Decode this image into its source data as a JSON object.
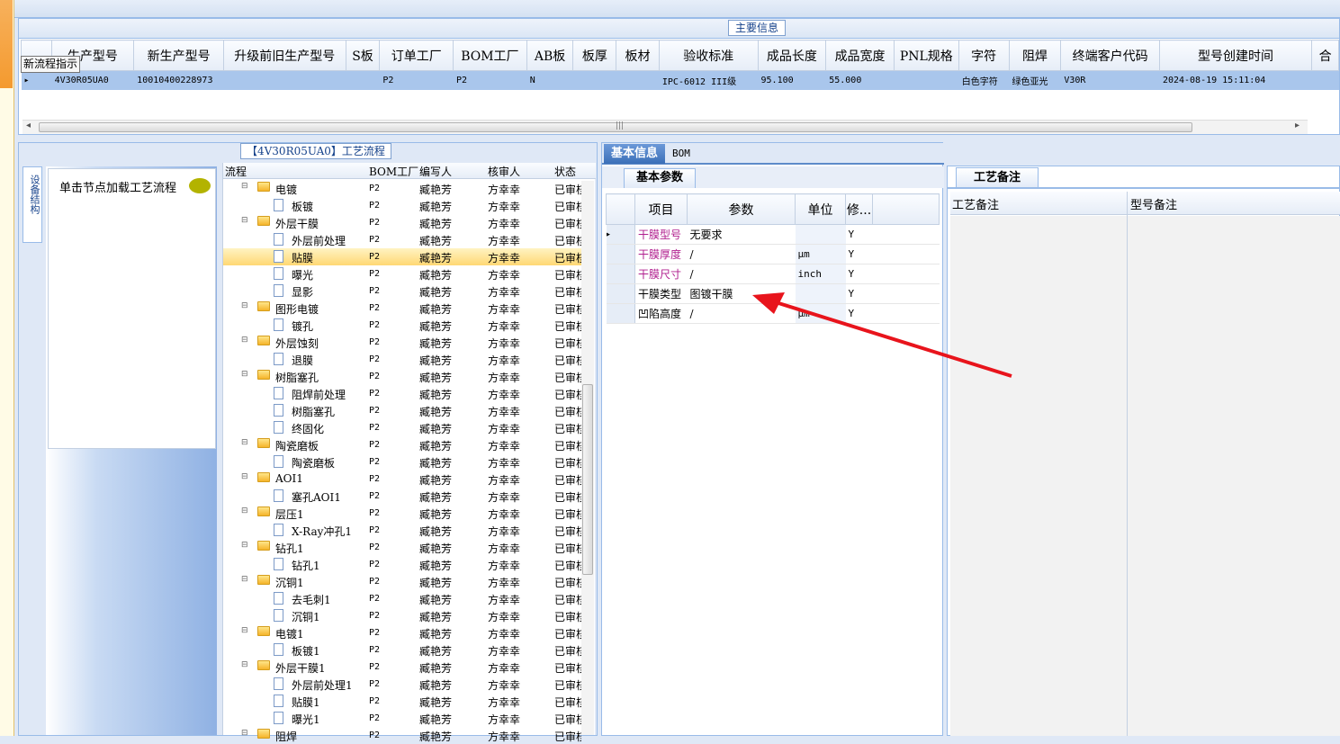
{
  "main_panel": {
    "title": "主要信息",
    "tooltip": "新流程指示",
    "columns": [
      "生产型号",
      "新生产型号",
      "升级前旧生产型号",
      "S板",
      "订单工厂",
      "BOM工厂",
      "AB板",
      "板厚",
      "板材",
      "验收标准",
      "成品长度",
      "成品宽度",
      "PNL规格",
      "字符",
      "阻焊",
      "终端客户代码",
      "型号创建时间",
      "合"
    ],
    "row": [
      "4V30R05UA0",
      "10010400228973",
      "",
      "",
      "P2",
      "P2",
      "N",
      "",
      "",
      "IPC-6012 III级",
      "95.100",
      "55.000",
      "",
      "白色字符",
      "绿色亚光",
      "V30R",
      "2024-08-19 15:11:04",
      ""
    ],
    "scroll_left": "◂",
    "scroll_right": "▸",
    "scroll_grip": "|||"
  },
  "process_panel": {
    "title": "【4V30R05UA0】工艺流程",
    "vertical_tab": "设备结构",
    "device_hint": "单击节点加载工艺流程",
    "columns": [
      "流程",
      "BOM工厂",
      "编写人",
      "核审人",
      "状态"
    ],
    "rows": [
      {
        "name": "电镀",
        "folder": true,
        "bom": "P2",
        "writer": "臧艳芳",
        "checker": "方幸幸",
        "status": "已审核"
      },
      {
        "name": "板镀",
        "folder": false,
        "bom": "P2",
        "writer": "臧艳芳",
        "checker": "方幸幸",
        "status": "已审核"
      },
      {
        "name": "外层干膜",
        "folder": true,
        "bom": "P2",
        "writer": "臧艳芳",
        "checker": "方幸幸",
        "status": "已审核"
      },
      {
        "name": "外层前处理",
        "folder": false,
        "bom": "P2",
        "writer": "臧艳芳",
        "checker": "方幸幸",
        "status": "已审核"
      },
      {
        "name": "贴膜",
        "folder": false,
        "bom": "P2",
        "writer": "臧艳芳",
        "checker": "方幸幸",
        "status": "已审核",
        "selected": true
      },
      {
        "name": "曝光",
        "folder": false,
        "bom": "P2",
        "writer": "臧艳芳",
        "checker": "方幸幸",
        "status": "已审核"
      },
      {
        "name": "显影",
        "folder": false,
        "bom": "P2",
        "writer": "臧艳芳",
        "checker": "方幸幸",
        "status": "已审核"
      },
      {
        "name": "图形电镀",
        "folder": true,
        "bom": "P2",
        "writer": "臧艳芳",
        "checker": "方幸幸",
        "status": "已审核"
      },
      {
        "name": "镀孔",
        "folder": false,
        "bom": "P2",
        "writer": "臧艳芳",
        "checker": "方幸幸",
        "status": "已审核"
      },
      {
        "name": "外层蚀刻",
        "folder": true,
        "bom": "P2",
        "writer": "臧艳芳",
        "checker": "方幸幸",
        "status": "已审核"
      },
      {
        "name": "退膜",
        "folder": false,
        "bom": "P2",
        "writer": "臧艳芳",
        "checker": "方幸幸",
        "status": "已审核"
      },
      {
        "name": "树脂塞孔",
        "folder": true,
        "bom": "P2",
        "writer": "臧艳芳",
        "checker": "方幸幸",
        "status": "已审核"
      },
      {
        "name": "阻焊前处理",
        "folder": false,
        "bom": "P2",
        "writer": "臧艳芳",
        "checker": "方幸幸",
        "status": "已审核"
      },
      {
        "name": "树脂塞孔",
        "folder": false,
        "bom": "P2",
        "writer": "臧艳芳",
        "checker": "方幸幸",
        "status": "已审核"
      },
      {
        "name": "终固化",
        "folder": false,
        "bom": "P2",
        "writer": "臧艳芳",
        "checker": "方幸幸",
        "status": "已审核"
      },
      {
        "name": "陶瓷磨板",
        "folder": true,
        "bom": "P2",
        "writer": "臧艳芳",
        "checker": "方幸幸",
        "status": "已审核"
      },
      {
        "name": "陶瓷磨板",
        "folder": false,
        "bom": "P2",
        "writer": "臧艳芳",
        "checker": "方幸幸",
        "status": "已审核"
      },
      {
        "name": "AOI1",
        "folder": true,
        "bom": "P2",
        "writer": "臧艳芳",
        "checker": "方幸幸",
        "status": "已审核"
      },
      {
        "name": "塞孔AOI1",
        "folder": false,
        "bom": "P2",
        "writer": "臧艳芳",
        "checker": "方幸幸",
        "status": "已审核"
      },
      {
        "name": "层压1",
        "folder": true,
        "bom": "P2",
        "writer": "臧艳芳",
        "checker": "方幸幸",
        "status": "已审核"
      },
      {
        "name": "X-Ray冲孔1",
        "folder": false,
        "bom": "P2",
        "writer": "臧艳芳",
        "checker": "方幸幸",
        "status": "已审核"
      },
      {
        "name": "钻孔1",
        "folder": true,
        "bom": "P2",
        "writer": "臧艳芳",
        "checker": "方幸幸",
        "status": "已审核"
      },
      {
        "name": "钻孔1",
        "folder": false,
        "bom": "P2",
        "writer": "臧艳芳",
        "checker": "方幸幸",
        "status": "已审核"
      },
      {
        "name": "沉铜1",
        "folder": true,
        "bom": "P2",
        "writer": "臧艳芳",
        "checker": "方幸幸",
        "status": "已审核"
      },
      {
        "name": "去毛刺1",
        "folder": false,
        "bom": "P2",
        "writer": "臧艳芳",
        "checker": "方幸幸",
        "status": "已审核"
      },
      {
        "name": "沉铜1",
        "folder": false,
        "bom": "P2",
        "writer": "臧艳芳",
        "checker": "方幸幸",
        "status": "已审核"
      },
      {
        "name": "电镀1",
        "folder": true,
        "bom": "P2",
        "writer": "臧艳芳",
        "checker": "方幸幸",
        "status": "已审核"
      },
      {
        "name": "板镀1",
        "folder": false,
        "bom": "P2",
        "writer": "臧艳芳",
        "checker": "方幸幸",
        "status": "已审核"
      },
      {
        "name": "外层干膜1",
        "folder": true,
        "bom": "P2",
        "writer": "臧艳芳",
        "checker": "方幸幸",
        "status": "已审核"
      },
      {
        "name": "外层前处理1",
        "folder": false,
        "bom": "P2",
        "writer": "臧艳芳",
        "checker": "方幸幸",
        "status": "已审核"
      },
      {
        "name": "贴膜1",
        "folder": false,
        "bom": "P2",
        "writer": "臧艳芳",
        "checker": "方幸幸",
        "status": "已审核"
      },
      {
        "name": "曝光1",
        "folder": false,
        "bom": "P2",
        "writer": "臧艳芳",
        "checker": "方幸幸",
        "status": "已审核"
      },
      {
        "name": "阻焊",
        "folder": true,
        "bom": "P2",
        "writer": "臧艳芳",
        "checker": "方幸幸",
        "status": "已审核"
      }
    ]
  },
  "detail_panel": {
    "tabs": [
      "基本信息",
      "BOM"
    ],
    "sub_tab": "基本参数",
    "columns": [
      "项目",
      "参数",
      "单位",
      "修..."
    ],
    "rows": [
      {
        "item": "干膜型号",
        "param": "无要求",
        "unit": "",
        "mod": "Y",
        "magenta": true
      },
      {
        "item": "干膜厚度",
        "param": "/",
        "unit": "μm",
        "mod": "Y",
        "magenta": true
      },
      {
        "item": "干膜尺寸",
        "param": "/",
        "unit": "inch",
        "mod": "Y",
        "magenta": true
      },
      {
        "item": "干膜类型",
        "param": "图镀干膜",
        "unit": "",
        "mod": "Y",
        "magenta": false
      },
      {
        "item": "凹陷高度",
        "param": "/",
        "unit": "μm",
        "mod": "Y",
        "magenta": false
      }
    ]
  },
  "notes_panel": {
    "tab": "工艺备注",
    "columns": [
      "工艺备注",
      "型号备注"
    ]
  },
  "colors": {
    "accent": "#15428b",
    "selected_row": "#a9c6ec",
    "arrow": "#e8141c",
    "magenta": "#b01e8e"
  },
  "icons": [
    "folder-icon",
    "document-icon",
    "speech-bubble-icon",
    "row-indicator-icon"
  ]
}
